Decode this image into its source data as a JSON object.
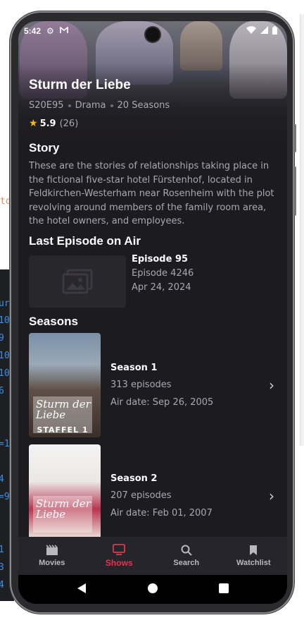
{
  "ide": {
    "orange_text": "to",
    "lines": [
      "ur",
      "10",
      "9",
      "10",
      "10",
      "6",
      "=1",
      "4",
      "=9",
      "1",
      "3",
      "4"
    ]
  },
  "status_bar": {
    "time": "5:42",
    "icons": [
      "gear-icon",
      "gmail-icon",
      "wifi-icon",
      "signal-icon",
      "battery-icon"
    ]
  },
  "show": {
    "title": "Sturm der Liebe",
    "episode_code": "S20E95",
    "genre": "Drama",
    "seasons_count": "20 Seasons",
    "rating": "5.9",
    "rating_count": "(26)"
  },
  "story": {
    "heading": "Story",
    "text": "These are the stories of relationships taking place in the fictional five-star hotel Fürstenhof, located in Feldkirchen-Westerham near Rosenheim with the plot revolving around members of the family room area, the hotel owners, and employees."
  },
  "last_episode": {
    "heading": "Last Episode on Air",
    "title": "Episode 95",
    "subtitle": "Episode 4246",
    "date": "Apr 24, 2024"
  },
  "seasons": {
    "heading": "Seasons",
    "items": [
      {
        "name": "Season 1",
        "episodes": "313 episodes",
        "air_date": "Air date: Sep 26, 2005",
        "poster_logo": "Sturm der Liebe",
        "poster_tag": "STAFFEL 1"
      },
      {
        "name": "Season 2",
        "episodes": "207 episodes",
        "air_date": "Air date: Feb 01, 2007",
        "poster_logo": "Sturm der Liebe",
        "poster_tag": ""
      }
    ]
  },
  "bottom_nav": {
    "items": [
      {
        "label": "Movies",
        "icon": "movies-icon",
        "active": false
      },
      {
        "label": "Shows",
        "icon": "tv-icon",
        "active": true
      },
      {
        "label": "Search",
        "icon": "search-icon",
        "active": false
      },
      {
        "label": "Watchlist",
        "icon": "bookmark-icon",
        "active": false
      }
    ],
    "active_color": "#e5344b"
  },
  "system_nav": [
    "back-icon",
    "home-icon",
    "recents-icon"
  ]
}
